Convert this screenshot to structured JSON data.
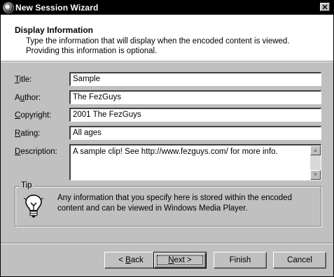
{
  "window": {
    "title": "New Session Wizard",
    "close_glyph": "✕"
  },
  "header": {
    "title": "Display Information",
    "description": "Type the information that will display when the encoded content is viewed. Providing this information is optional."
  },
  "fields": {
    "title": {
      "label_acc": "T",
      "label_rest": "itle:",
      "value": "Sample"
    },
    "author": {
      "label_pre": "A",
      "label_acc": "u",
      "label_rest": "thor:",
      "value": "The FezGuys"
    },
    "copyright": {
      "label_acc": "C",
      "label_rest": "opyright:",
      "value": "2001 The FezGuys"
    },
    "rating": {
      "label_acc": "R",
      "label_rest": "ating:",
      "value": "All ages"
    },
    "description": {
      "label_acc": "D",
      "label_rest": "escription:",
      "value": "A sample clip! See http://www.fezguys.com/ for more info."
    }
  },
  "tip": {
    "legend": "Tip",
    "icon": "lightbulb-tip-icon",
    "text": "Any information that you specify here is stored within the encoded content and can be viewed in Windows Media Player."
  },
  "buttons": {
    "back": {
      "prefix": "< ",
      "acc": "B",
      "rest": "ack"
    },
    "next": {
      "acc": "N",
      "rest": "ext >"
    },
    "finish": "Finish",
    "cancel": "Cancel"
  }
}
